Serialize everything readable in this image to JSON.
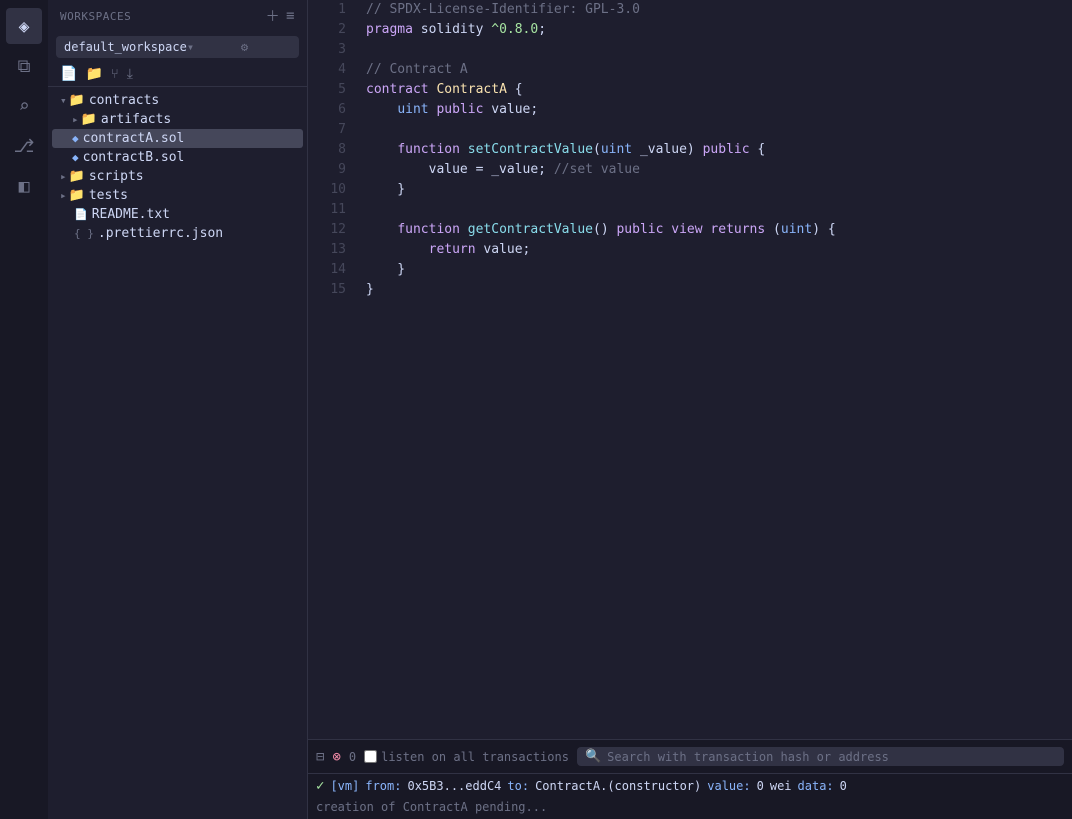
{
  "activityBar": {
    "icons": [
      {
        "name": "remix-logo",
        "symbol": "◈",
        "active": true
      },
      {
        "name": "files-icon",
        "symbol": "⧉",
        "active": false
      },
      {
        "name": "search-icon",
        "symbol": "⌕",
        "active": false
      },
      {
        "name": "git-icon",
        "symbol": "⎇",
        "active": false
      },
      {
        "name": "plugin-icon",
        "symbol": "◧",
        "active": false
      }
    ]
  },
  "sidebar": {
    "workspaces_label": "WORKSPACES",
    "add_workspace_tooltip": "Add workspace",
    "menu_icon_tooltip": "Menu",
    "workspace_name": "default_workspace",
    "file_tree_icons": [
      "new-file",
      "new-folder",
      "github",
      "load"
    ],
    "tree": [
      {
        "id": "contracts-folder",
        "type": "folder",
        "label": "contracts",
        "indent": 0,
        "expanded": true
      },
      {
        "id": "artifacts-folder",
        "type": "folder",
        "label": "artifacts",
        "indent": 1,
        "expanded": false
      },
      {
        "id": "contractA-sol",
        "type": "sol",
        "label": "contractA.sol",
        "indent": 1,
        "active": true
      },
      {
        "id": "contractB-sol",
        "type": "sol",
        "label": "contractB.sol",
        "indent": 1,
        "active": false
      },
      {
        "id": "scripts-folder",
        "type": "folder",
        "label": "scripts",
        "indent": 0,
        "expanded": false
      },
      {
        "id": "tests-folder",
        "type": "folder",
        "label": "tests",
        "indent": 0,
        "expanded": false
      },
      {
        "id": "readme-txt",
        "type": "file",
        "label": "README.txt",
        "indent": 0
      },
      {
        "id": "prettierrc",
        "type": "json",
        "label": ".prettierrc.json",
        "indent": 0
      }
    ]
  },
  "editor": {
    "filename": "contractA.sol",
    "lines": [
      {
        "num": 1,
        "dot": true,
        "tokens": [
          {
            "cls": "c-comment",
            "text": "// SPDX-License-Identifier: GPL-3.0"
          }
        ]
      },
      {
        "num": 2,
        "dot": false,
        "tokens": [
          {
            "cls": "c-pragma",
            "text": "pragma"
          },
          {
            "cls": "c-plain",
            "text": " "
          },
          {
            "cls": "c-plain",
            "text": "solidity"
          },
          {
            "cls": "c-plain",
            "text": " "
          },
          {
            "cls": "c-version",
            "text": "^0.8.0"
          },
          {
            "cls": "c-plain",
            "text": ";"
          }
        ]
      },
      {
        "num": 3,
        "dot": false,
        "tokens": []
      },
      {
        "num": 4,
        "dot": true,
        "tokens": [
          {
            "cls": "c-comment",
            "text": "// Contract A"
          }
        ]
      },
      {
        "num": 5,
        "dot": false,
        "tokens": [
          {
            "cls": "c-keyword",
            "text": "contract"
          },
          {
            "cls": "c-plain",
            "text": " "
          },
          {
            "cls": "c-contract-name",
            "text": "ContractA"
          },
          {
            "cls": "c-plain",
            "text": " {"
          }
        ]
      },
      {
        "num": 6,
        "dot": false,
        "tokens": [
          {
            "cls": "c-plain",
            "text": "    "
          },
          {
            "cls": "c-type",
            "text": "uint"
          },
          {
            "cls": "c-plain",
            "text": " "
          },
          {
            "cls": "c-keyword",
            "text": "public"
          },
          {
            "cls": "c-plain",
            "text": " value;"
          }
        ]
      },
      {
        "num": 7,
        "dot": false,
        "tokens": []
      },
      {
        "num": 8,
        "dot": false,
        "tokens": [
          {
            "cls": "c-plain",
            "text": "    "
          },
          {
            "cls": "c-keyword",
            "text": "function"
          },
          {
            "cls": "c-plain",
            "text": " "
          },
          {
            "cls": "c-function",
            "text": "setContractValue"
          },
          {
            "cls": "c-plain",
            "text": "("
          },
          {
            "cls": "c-type",
            "text": "uint"
          },
          {
            "cls": "c-plain",
            "text": " _value) "
          },
          {
            "cls": "c-keyword",
            "text": "public"
          },
          {
            "cls": "c-plain",
            "text": " {"
          }
        ]
      },
      {
        "num": 9,
        "dot": false,
        "tokens": [
          {
            "cls": "c-plain",
            "text": "        value = _value; "
          },
          {
            "cls": "c-comment",
            "text": "//set value"
          }
        ]
      },
      {
        "num": 10,
        "dot": false,
        "tokens": [
          {
            "cls": "c-plain",
            "text": "    }"
          }
        ]
      },
      {
        "num": 11,
        "dot": false,
        "tokens": []
      },
      {
        "num": 12,
        "dot": false,
        "tokens": [
          {
            "cls": "c-plain",
            "text": "    "
          },
          {
            "cls": "c-keyword",
            "text": "function"
          },
          {
            "cls": "c-plain",
            "text": " "
          },
          {
            "cls": "c-function",
            "text": "getContractValue"
          },
          {
            "cls": "c-plain",
            "text": "() "
          },
          {
            "cls": "c-keyword",
            "text": "public"
          },
          {
            "cls": "c-plain",
            "text": " "
          },
          {
            "cls": "c-modifier",
            "text": "view"
          },
          {
            "cls": "c-plain",
            "text": " "
          },
          {
            "cls": "c-keyword",
            "text": "returns"
          },
          {
            "cls": "c-plain",
            "text": " ("
          },
          {
            "cls": "c-type",
            "text": "uint"
          },
          {
            "cls": "c-plain",
            "text": ") {"
          }
        ]
      },
      {
        "num": 13,
        "dot": false,
        "tokens": [
          {
            "cls": "c-plain",
            "text": "        "
          },
          {
            "cls": "c-keyword",
            "text": "return"
          },
          {
            "cls": "c-plain",
            "text": " value;"
          }
        ]
      },
      {
        "num": 14,
        "dot": false,
        "tokens": [
          {
            "cls": "c-plain",
            "text": "    }"
          }
        ]
      },
      {
        "num": 15,
        "dot": false,
        "tokens": [
          {
            "cls": "c-plain",
            "text": "}"
          }
        ]
      }
    ]
  },
  "bottomPanel": {
    "transaction_count": "0",
    "listen_label": "listen on all transactions",
    "search_placeholder": "Search with transaction hash or address",
    "log": {
      "tag": "[vm]",
      "from_label": "from:",
      "from_value": "0x5B3...eddC4",
      "to_label": "to:",
      "to_value": "ContractA.(constructor)",
      "value_label": "value:",
      "value_num": "0",
      "value_unit": "wei",
      "data_label": "data:",
      "data_value": "0"
    },
    "creation_text": "creation of ContractA pending..."
  }
}
